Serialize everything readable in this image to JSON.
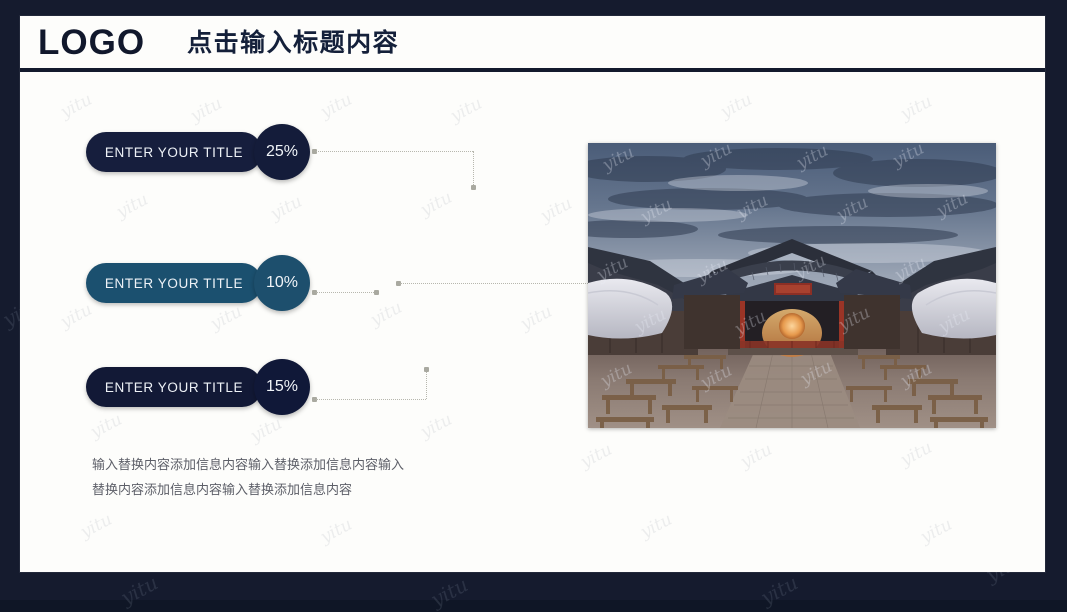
{
  "slide": {
    "header": {
      "logo": "LOGO",
      "title": "点击输入标题内容"
    },
    "rows": [
      {
        "label": "ENTER YOUR TITLE",
        "percent": "25%",
        "pill_color": "#161e3d",
        "circle_color": "#141c3a"
      },
      {
        "label": "ENTER YOUR TITLE",
        "percent": "10%",
        "pill_color": "#1b506f",
        "circle_color": "#1d4f6d"
      },
      {
        "label": "ENTER YOUR TITLE",
        "percent": "15%",
        "pill_color": "#121936",
        "circle_color": "#101838"
      }
    ],
    "body_text": "输入替换内容添加信息内容输入替换添加信息内容输入替换内容添加信息内容输入替换添加信息内容",
    "photo_alt": "传统中式庭院夜景",
    "watermark": "yitu",
    "colors": {
      "frame": "#151b2e",
      "card": "#fdfdfb",
      "rule": "#131a2d",
      "accent_navy": "#161e3d",
      "accent_teal": "#1b506f",
      "connector": "#b7b7ae",
      "body_text": "#5d5f68"
    }
  }
}
